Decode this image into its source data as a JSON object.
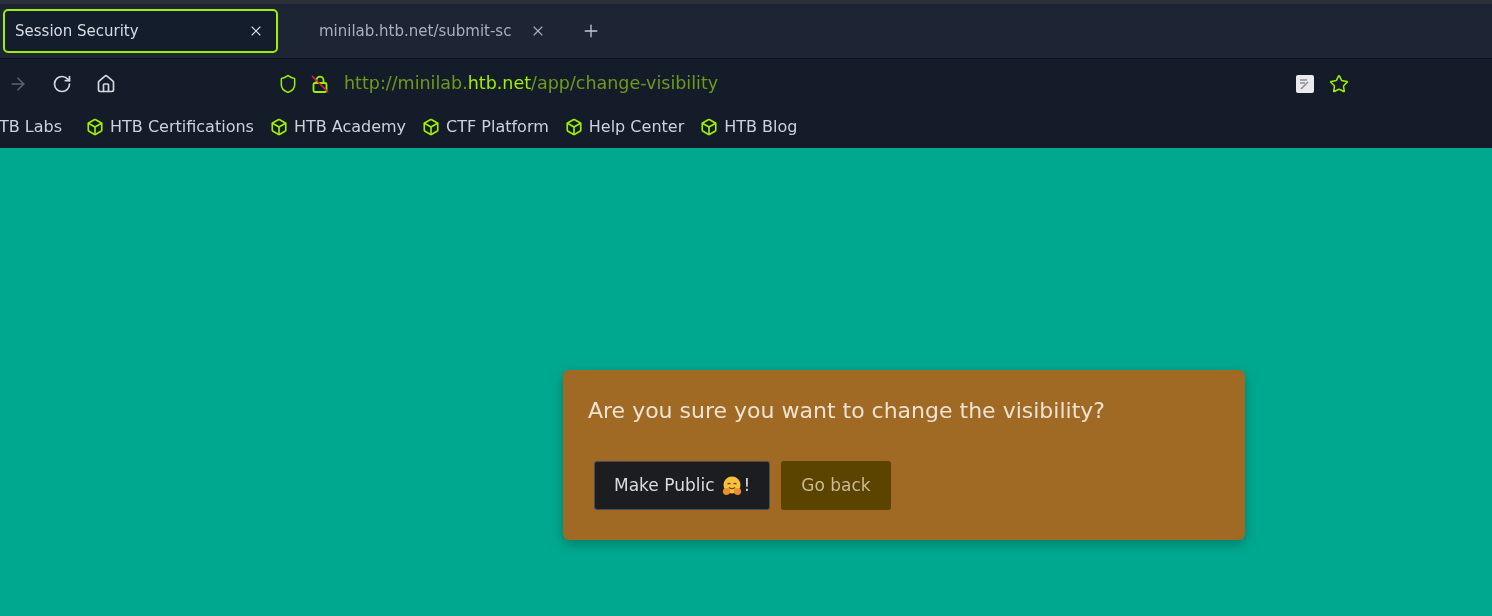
{
  "tabs": [
    {
      "title": "Session Security",
      "selected": true
    },
    {
      "title": "minilab.htb.net/submit-sc",
      "selected": false
    }
  ],
  "toolbar": {
    "nav_buttons": [
      {
        "kind": "forward",
        "disabled": true
      },
      {
        "kind": "reload",
        "disabled": false
      },
      {
        "kind": "home",
        "disabled": false
      }
    ],
    "insecure": true,
    "url": {
      "start": "http://minilab.",
      "domain": "htb.net",
      "path": "/app/change-visibility"
    }
  },
  "bookmarks": [
    {
      "label": "TB Labs",
      "kind": "partial"
    },
    {
      "label": "HTB Certifications",
      "kind": "full"
    },
    {
      "label": "HTB Academy",
      "kind": "full"
    },
    {
      "label": "CTF Platform",
      "kind": "full"
    },
    {
      "label": "Help Center",
      "kind": "full"
    },
    {
      "label": "HTB Blog",
      "kind": "full"
    }
  ],
  "dialog": {
    "question": "Are you sure you want to change the visibility?",
    "buttons": [
      {
        "kind": "primary",
        "label": "Make Public",
        "suffix": "!"
      },
      {
        "kind": "secondary",
        "label": "Go back"
      }
    ]
  }
}
